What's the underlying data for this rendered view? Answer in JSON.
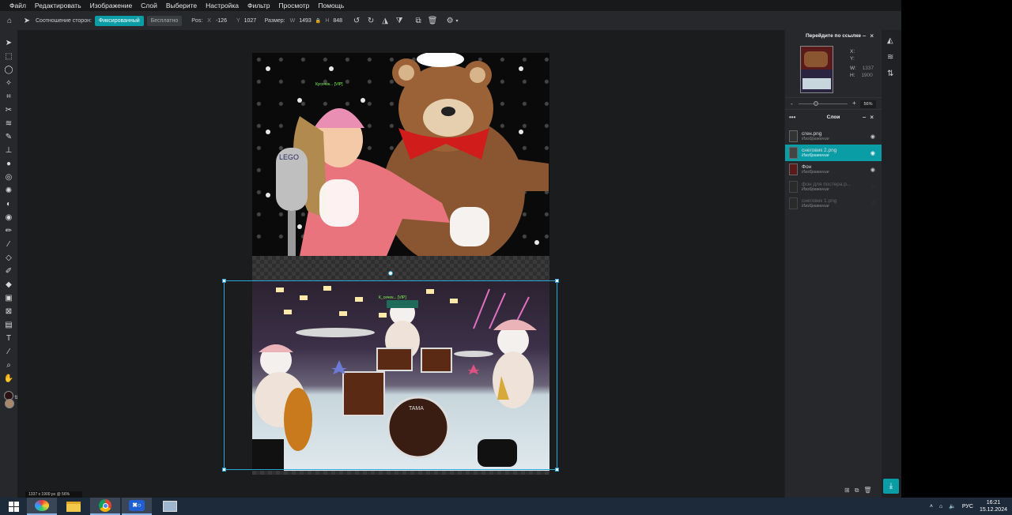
{
  "menu": [
    "Файл",
    "Редактировать",
    "Изображение",
    "Слой",
    "Выберите",
    "Настройка",
    "Фильтр",
    "Просмотр",
    "Помощь"
  ],
  "options": {
    "aspect_label": "Соотношение сторон:",
    "fixed_label": "Фиксированный",
    "free_label": "Бесплатно",
    "pos_label": "Pos:",
    "x_label": "X",
    "x_value": "-126",
    "y_label": "Y",
    "y_value": "1027",
    "size_label": "Размер:",
    "w_label": "W",
    "w_value": "1493",
    "h_label": "H",
    "h_value": "848"
  },
  "navigator": {
    "title": "Перейдите по ссылке",
    "x_label": "X:",
    "y_label": "Y:",
    "w_label": "W:",
    "w_value": "1337",
    "h_label": "H:",
    "h_value": "1900",
    "zoom_minus": "-",
    "zoom_plus": "+",
    "zoom_value": "56%"
  },
  "layers_panel": {
    "title": "Слои",
    "layers": [
      {
        "name": "сген.png",
        "type": "Изображение"
      },
      {
        "name": "снеговик 2.png",
        "type": "Изображение"
      },
      {
        "name": "Фон",
        "type": "Изображение"
      },
      {
        "name": "фон для постера.p...",
        "type": "Изображение"
      },
      {
        "name": "снеговик 1.png",
        "type": "Изображение"
      }
    ]
  },
  "status_bar": {
    "doc_info": "1337 x 1900 px @ 56%"
  },
  "canvas_text": {
    "top_nametag": "Кусочек... [VIP]",
    "bottom_nametag": "К_сечек... [VIP]"
  },
  "taskbar": {
    "lang": "РУС",
    "time": "16:21",
    "date": "15.12.2024"
  },
  "colors": {
    "accent": "#0b9da6",
    "selection": "#2aa7d8",
    "fg_swatch": "#2a1214",
    "bg_swatch": "#a8876a"
  }
}
